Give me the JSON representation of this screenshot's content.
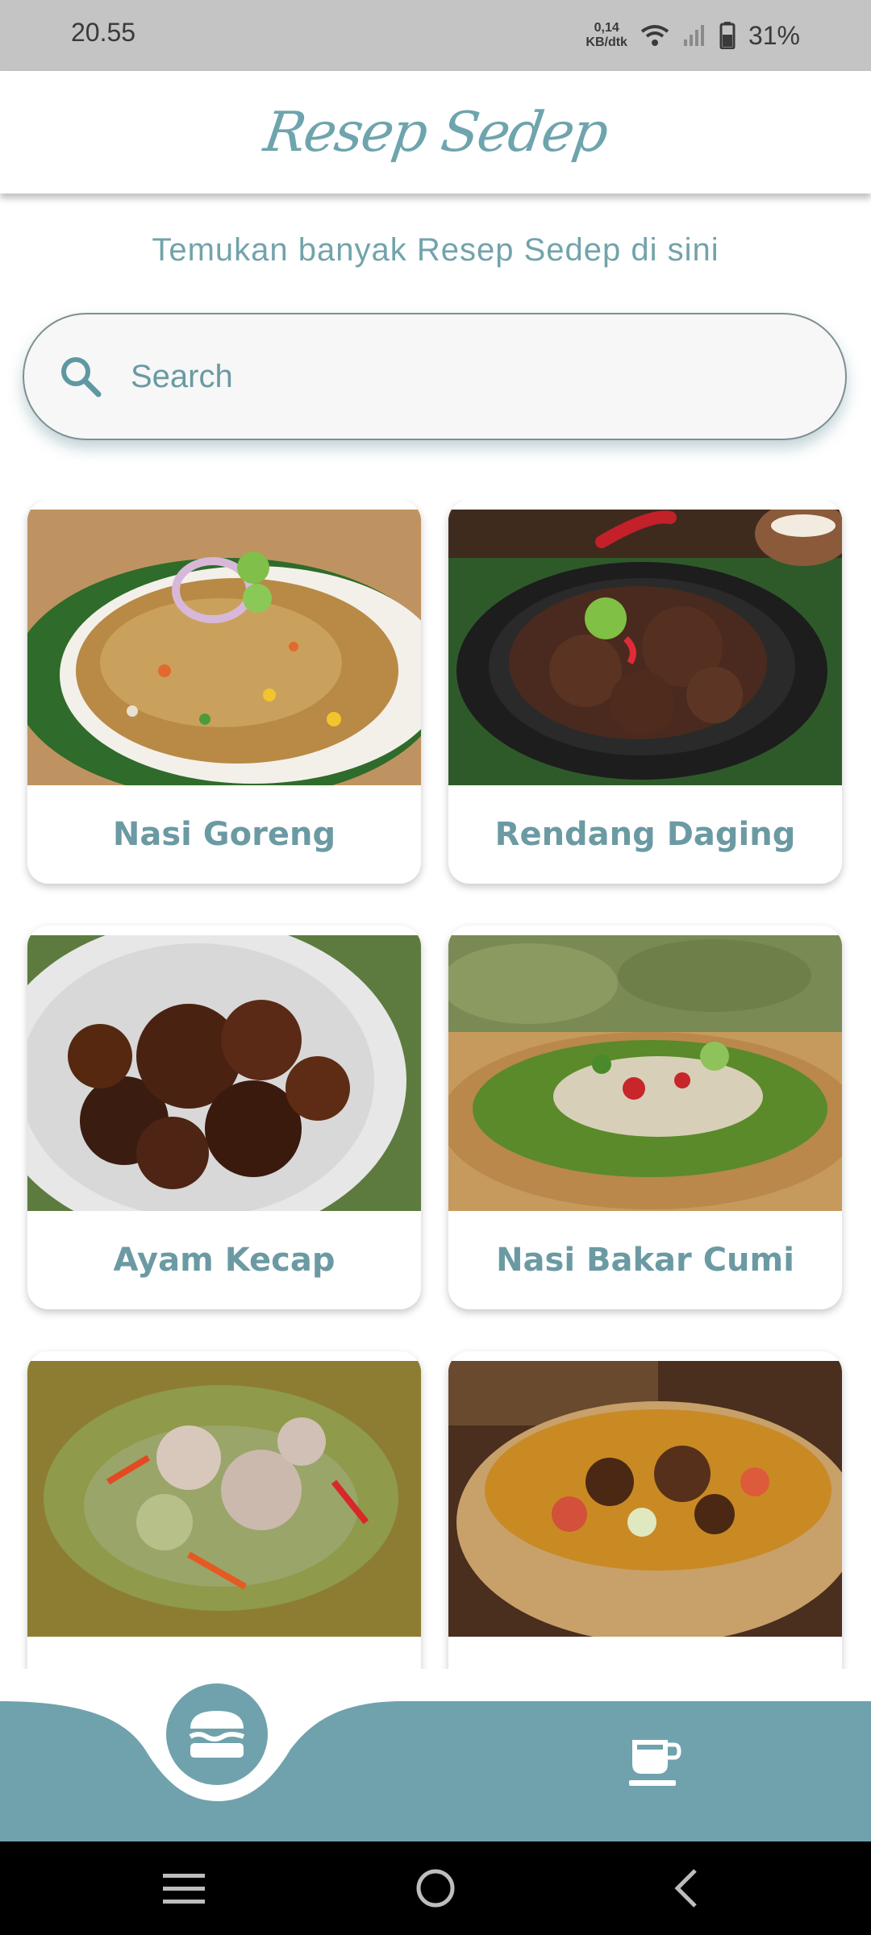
{
  "status": {
    "time": "20.55",
    "net_value": "0,14",
    "net_unit": "KB/dtk",
    "battery": "31%"
  },
  "app": {
    "title": "Resep Sedep"
  },
  "subtitle": "Temukan banyak Resep Sedep di sini",
  "search": {
    "placeholder": "Search",
    "value": ""
  },
  "recipes": [
    {
      "label": "Nasi Goreng"
    },
    {
      "label": "Rendang Daging"
    },
    {
      "label": "Ayam Kecap"
    },
    {
      "label": "Nasi Bakar Cumi"
    },
    {
      "label": ""
    },
    {
      "label": ""
    }
  ],
  "nav": {
    "items": [
      "burger-icon",
      "coffee-icon"
    ],
    "active": "burger-icon"
  },
  "colors": {
    "accent": "#6fa2ac",
    "text": "#6b9aa3"
  }
}
